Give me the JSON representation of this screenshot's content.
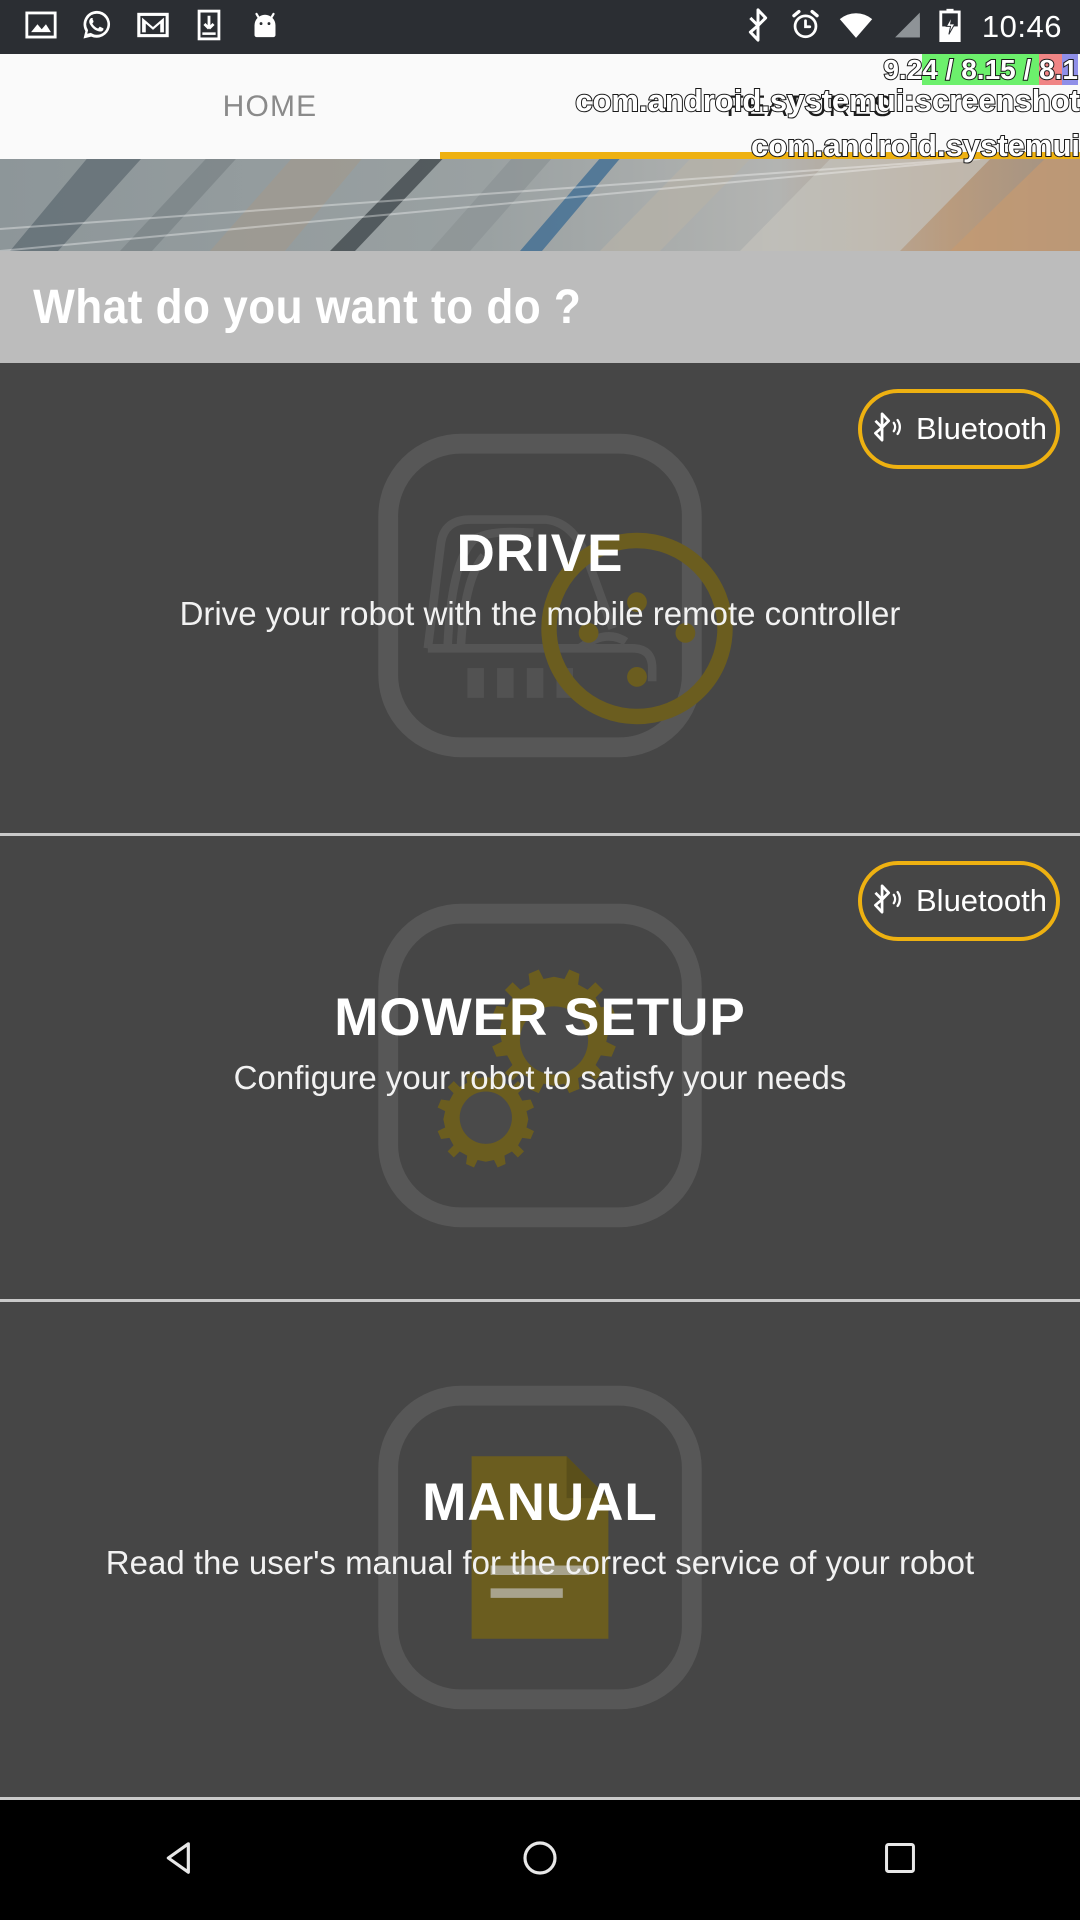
{
  "statusbar": {
    "icons_left": [
      "gallery-icon",
      "whatsapp-icon",
      "gmail-icon",
      "download-icon",
      "android-head-icon"
    ],
    "icons_right": [
      "bluetooth-icon",
      "alarm-icon",
      "wifi-icon",
      "cellular-signal-icon",
      "battery-charging-icon"
    ],
    "clock": "10:46"
  },
  "debug_overlay": {
    "frame_times": {
      "v1": "9.2",
      "v2": "4",
      "sep1": " / ",
      "v3": "8.15",
      "sep2": " / ",
      "v4": "8.",
      "v5": "1",
      "full": "9.24 / 8.15 / 8.1"
    },
    "line2": "com.android.systemui:screenshot",
    "line3": "com.android.systemui"
  },
  "tabs": [
    {
      "label": "HOME",
      "active": false
    },
    {
      "label": "FEATURES",
      "active": true
    }
  ],
  "header": {
    "question": "What do you want to do ?"
  },
  "cards": [
    {
      "title": "DRIVE",
      "subtitle": "Drive your robot with the mobile remote controller",
      "bluetooth_label": "Bluetooth",
      "has_bluetooth": true,
      "watermark": "mower-outline-icon"
    },
    {
      "title": "MOWER SETUP",
      "subtitle": "Configure your robot to satisfy your needs",
      "bluetooth_label": "Bluetooth",
      "has_bluetooth": true,
      "watermark": "gears-icon"
    },
    {
      "title": "MANUAL",
      "subtitle": "Read the user's manual for the correct service of your robot",
      "bluetooth_label": "",
      "has_bluetooth": false,
      "watermark": "document-icon"
    }
  ],
  "navbar": {
    "back": "back-triangle-icon",
    "home": "home-circle-icon",
    "recents": "recents-square-icon"
  },
  "colors": {
    "accent": "#eeb111",
    "statusbar_bg": "#2b2e33",
    "tabbar_bg": "#fafafa",
    "band_bg": "#bcbcbc",
    "card_bg": "#464646",
    "navbar_bg": "#000000",
    "watermark_olive": "#6b5d1f"
  }
}
